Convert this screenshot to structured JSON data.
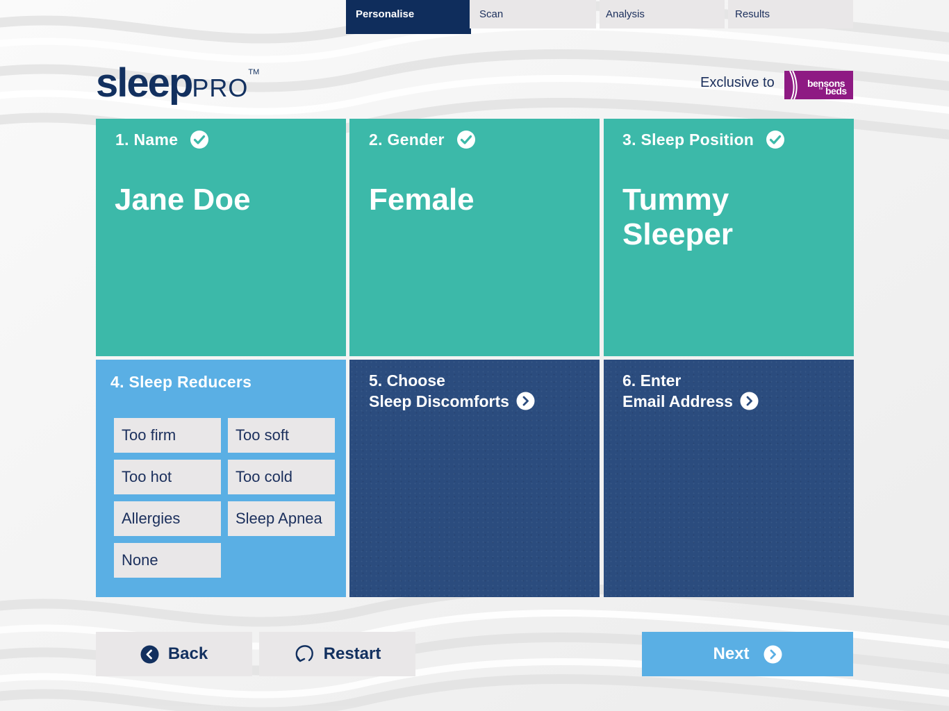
{
  "steps": [
    {
      "label": "Personalise",
      "active": true
    },
    {
      "label": "Scan",
      "active": false
    },
    {
      "label": "Analysis",
      "active": false
    },
    {
      "label": "Results",
      "active": false
    }
  ],
  "brand": {
    "logo_sleep": "sleep",
    "logo_pro": "PRO",
    "logo_tm": "TM",
    "exclusive_text": "Exclusive to",
    "partner_name_line1": "bensons",
    "partner_name_small": "for",
    "partner_name_line2": "beds"
  },
  "cards": {
    "name": {
      "title": "1. Name",
      "value": "Jane Doe",
      "completed": true
    },
    "gender": {
      "title": "2. Gender",
      "value": "Female",
      "completed": true
    },
    "position": {
      "title": "3. Sleep Position",
      "value_line1": "Tummy",
      "value_line2": "Sleeper",
      "completed": true
    },
    "reducers": {
      "title": "4. Sleep Reducers",
      "options": [
        "Too firm",
        "Too soft",
        "Too hot",
        "Too cold",
        "Allergies",
        "Sleep Apnea",
        "None"
      ]
    },
    "discomforts": {
      "title_line1": "5. Choose",
      "title_line2": "Sleep Discomforts"
    },
    "email": {
      "title_line1": "6. Enter",
      "title_line2": "Email Address"
    }
  },
  "buttons": {
    "back": "Back",
    "restart": "Restart",
    "next": "Next"
  },
  "colors": {
    "navy": "#0f2d5c",
    "teal": "#3cb9a9",
    "light_blue": "#5aafe4",
    "dark_blue_card": "#2b4c7e",
    "button_grey": "#e9e7e8",
    "partner_purple": "#8e1a83"
  }
}
